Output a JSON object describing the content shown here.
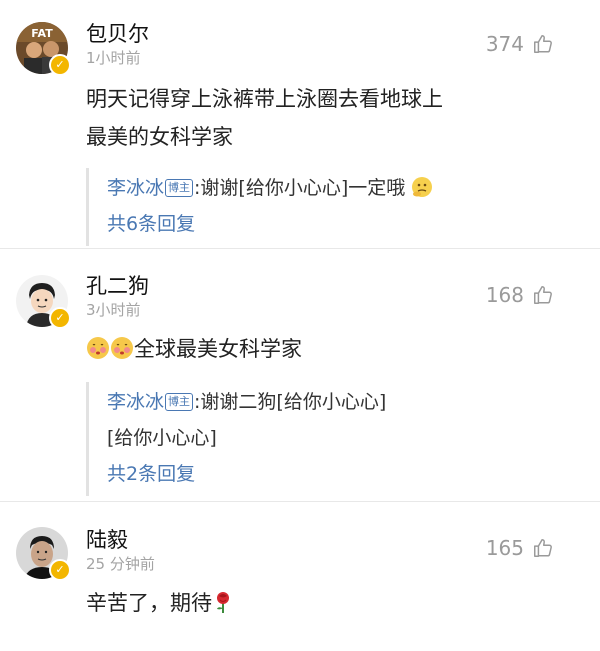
{
  "comments": [
    {
      "name": "包贝尔",
      "time": "1小时前",
      "likes": "374",
      "text_line1": "明天记得穿上泳裤带上泳圈去看地球上",
      "text_line2": "最美的女科学家",
      "reply": {
        "author": "李冰冰",
        "badge": "博主",
        "text": ":谢谢[给你小心心]一定哦",
        "more": "共6条回复"
      },
      "avatar_label": "FAT"
    },
    {
      "name": "孔二狗",
      "time": "3小时前",
      "likes": "168",
      "text": "全球最美女科学家",
      "reply": {
        "author": "李冰冰",
        "badge": "博主",
        "text_line1": ":谢谢二狗[给你小心心]",
        "text_line2": "[给你小心心]",
        "more": "共2条回复"
      }
    },
    {
      "name": "陆毅",
      "time": "25 分钟前",
      "likes": "165",
      "text": "辛苦了，期待"
    }
  ],
  "icons": {
    "like": "thumbs-up-icon",
    "verified": "verified-badge-icon"
  },
  "colors": {
    "link": "#4a78b3",
    "muted": "#a4a4a4",
    "verified": "#f3b600"
  }
}
